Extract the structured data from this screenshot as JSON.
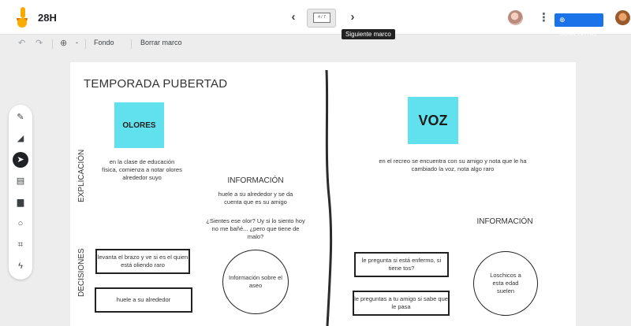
{
  "header": {
    "title": "28H",
    "frame_indicator": "4 / 7",
    "tooltip": "Siguiente marco",
    "share_label": "COMPARTIR"
  },
  "toolbar": {
    "zoom_label": "-",
    "background_label": "Fondo",
    "clear_frame_label": "Borrar marco"
  },
  "side_tools": [
    "pen-icon",
    "eraser-icon",
    "select-icon",
    "sticky-note-icon",
    "image-icon",
    "circle-shape-icon",
    "text-box-icon",
    "laser-icon"
  ],
  "board": {
    "title": "TEMPORADA PUBERTAD",
    "left": {
      "sticky": "OLORES",
      "explanation_label": "EXPLICACIÓN",
      "explanation_text": "en la clase de educación física, comienza a notar olores alrededor suyo",
      "info_heading": "INFORMACIÓN",
      "info_text": "huele a su alrededor y se da cuenta que es  su amigo",
      "questions": "¿Sientes ese olor? Uy si lo siento hoy no me bañé... ¿pero que tiene de malo?",
      "decisions_label": "DECISIONES",
      "decision_1": "levanta el brazo y ve si es el quien está oliendo raro",
      "decision_2": "huele a su alrededor",
      "circle": "Información sobre el aseo"
    },
    "right": {
      "sticky": "VOZ",
      "explanation_text": "en el recreo se encuentra con su amigo y  nota que le ha cambiado la voz, nota algo raro",
      "info_heading": "INFORMACIÓN",
      "decision_1": "le pregunta si está enfermo, si tiene tos?",
      "decision_2": "le preguntas a tu amigo si sabe que le pasa",
      "circle": "Loschicos a esta edad suelen"
    }
  },
  "colors": {
    "sticky": "#61e1ee",
    "accent": "#1a73e8",
    "logo": "#f9ab00"
  }
}
